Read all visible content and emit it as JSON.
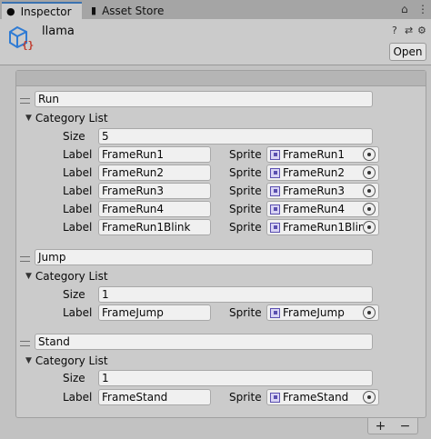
{
  "tabs": [
    {
      "label": "Inspector",
      "icon": "info-icon"
    },
    {
      "label": "Asset Store",
      "icon": "store-bag-icon"
    }
  ],
  "tab_controls": {
    "lock": "lock-icon",
    "menu": "kebab-menu-icon"
  },
  "header": {
    "title": "llama",
    "open_label": "Open",
    "icons": [
      "help-icon",
      "presets-icon",
      "settings-icon"
    ]
  },
  "labels": {
    "category_list": "Category List",
    "size": "Size",
    "label": "Label",
    "sprite": "Sprite"
  },
  "categories": [
    {
      "name": "Run",
      "size": "5",
      "entries": [
        {
          "label": "FrameRun1",
          "sprite": "FrameRun1"
        },
        {
          "label": "FrameRun2",
          "sprite": "FrameRun2"
        },
        {
          "label": "FrameRun3",
          "sprite": "FrameRun3"
        },
        {
          "label": "FrameRun4",
          "sprite": "FrameRun4"
        },
        {
          "label": "FrameRun1Blink",
          "sprite": "FrameRun1Blink"
        }
      ]
    },
    {
      "name": "Jump",
      "size": "1",
      "entries": [
        {
          "label": "FrameJump",
          "sprite": "FrameJump"
        }
      ]
    },
    {
      "name": "Stand",
      "size": "1",
      "entries": [
        {
          "label": "FrameStand",
          "sprite": "FrameStand"
        }
      ]
    }
  ],
  "footer": {
    "add": "+",
    "remove": "−"
  },
  "colors": {
    "accent": "#3a72b0",
    "field_bg": "#f0f0f0",
    "panel_bg": "#cbcbcb"
  }
}
